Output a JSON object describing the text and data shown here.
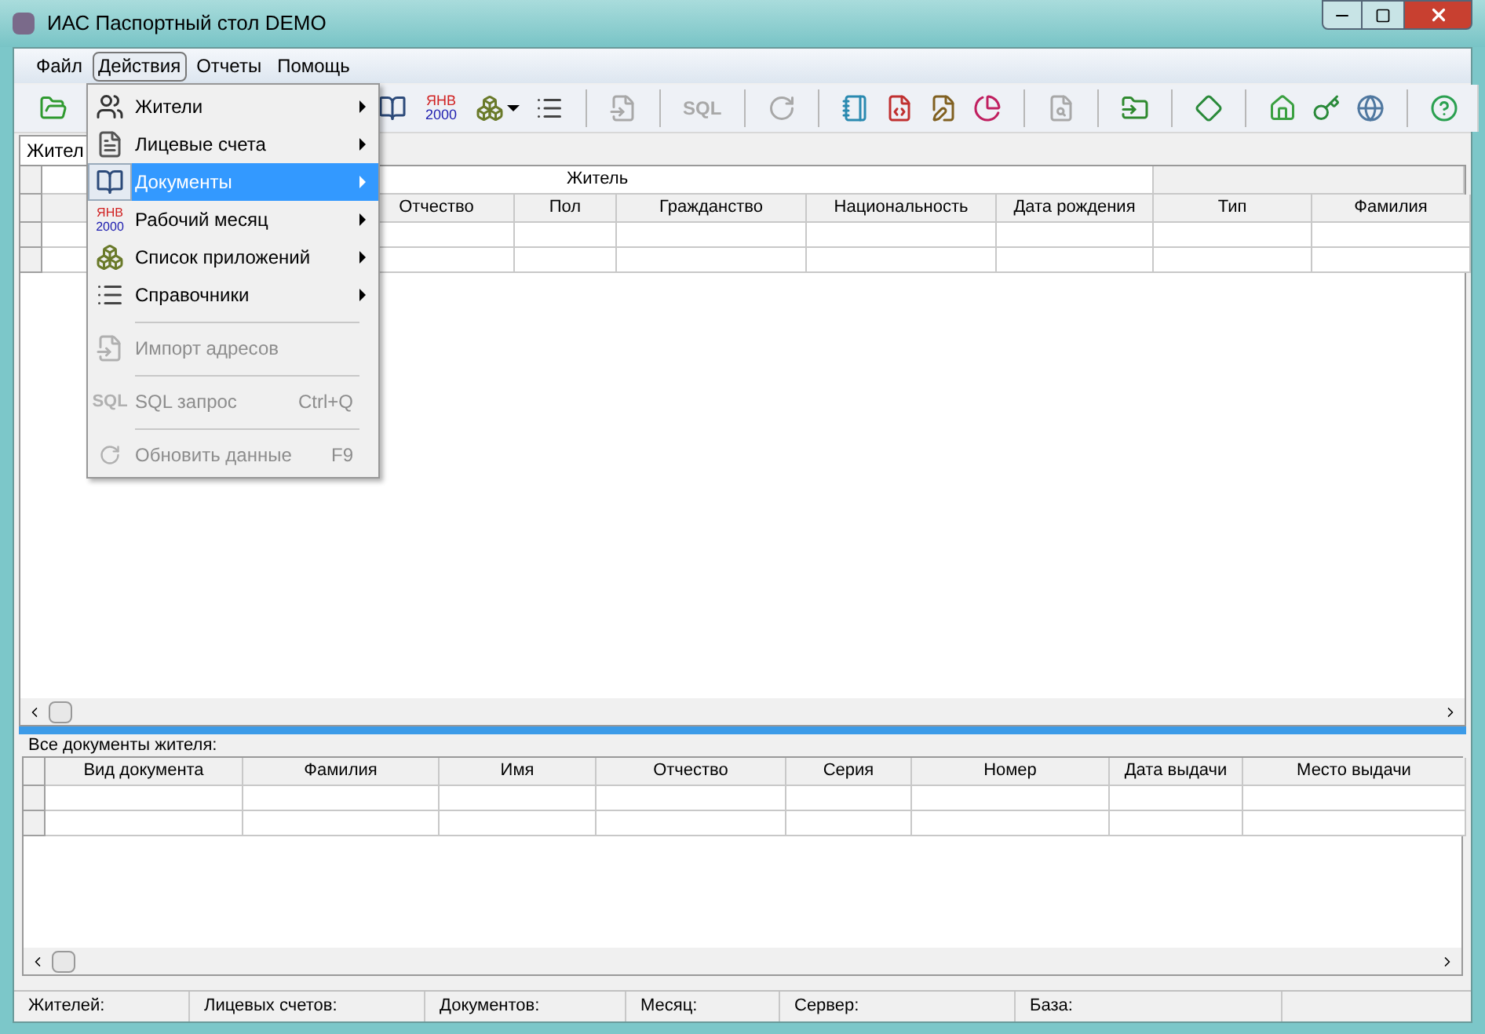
{
  "window": {
    "title": "ИАС Паспортный стол DEMO"
  },
  "menu_bar": [
    {
      "label": "Файл",
      "selected": false
    },
    {
      "label": "Действия",
      "selected": true
    },
    {
      "label": "Отчеты",
      "selected": false
    },
    {
      "label": "Помощь",
      "selected": false
    }
  ],
  "toolbar": {
    "month_text": [
      "ЯНВ",
      "2000"
    ],
    "sql_text": "SQL"
  },
  "dropdown": [
    {
      "kind": "item",
      "label": "Жители",
      "submenu": true,
      "selected": false,
      "disabled": false
    },
    {
      "kind": "item",
      "label": "Лицевые счета",
      "submenu": true,
      "selected": false,
      "disabled": false
    },
    {
      "kind": "item",
      "label": "Документы",
      "submenu": true,
      "selected": true,
      "disabled": false
    },
    {
      "kind": "item",
      "label": "Рабочий месяц",
      "submenu": true,
      "selected": false,
      "disabled": false,
      "icon_text": [
        "ЯНВ",
        "2000"
      ]
    },
    {
      "kind": "item",
      "label": "Список приложений",
      "submenu": true,
      "selected": false,
      "disabled": false
    },
    {
      "kind": "item",
      "label": "Справочники",
      "submenu": true,
      "selected": false,
      "disabled": false
    },
    {
      "kind": "separator"
    },
    {
      "kind": "item",
      "label": "Импорт адресов",
      "submenu": false,
      "selected": false,
      "disabled": true
    },
    {
      "kind": "separator"
    },
    {
      "kind": "item",
      "label": "SQL запрос",
      "shortcut": "Ctrl+Q",
      "submenu": false,
      "selected": false,
      "disabled": true,
      "icon_text": [
        "SQL"
      ]
    },
    {
      "kind": "separator"
    },
    {
      "kind": "item",
      "label": "Обновить данные",
      "shortcut": "F9",
      "submenu": false,
      "selected": false,
      "disabled": true
    }
  ],
  "tabs": [
    {
      "label": "Жител",
      "selected": true
    }
  ],
  "residents_table": {
    "group_header": "Житель",
    "columns": [
      "Отчество",
      "Пол",
      "Гражданство",
      "Национальность",
      "Дата рождения",
      "Тип",
      "Фамилия"
    ]
  },
  "documents_label": "Все документы жителя:",
  "documents_table": {
    "columns": [
      "Вид документа",
      "Фамилия",
      "Имя",
      "Отчество",
      "Серия",
      "Номер",
      "Дата выдачи",
      "Место выдачи"
    ]
  },
  "status_bar": [
    "Жителей:",
    "Лицевых счетов:",
    "Документов:",
    "Месяц:",
    "Сервер:",
    "База:"
  ]
}
